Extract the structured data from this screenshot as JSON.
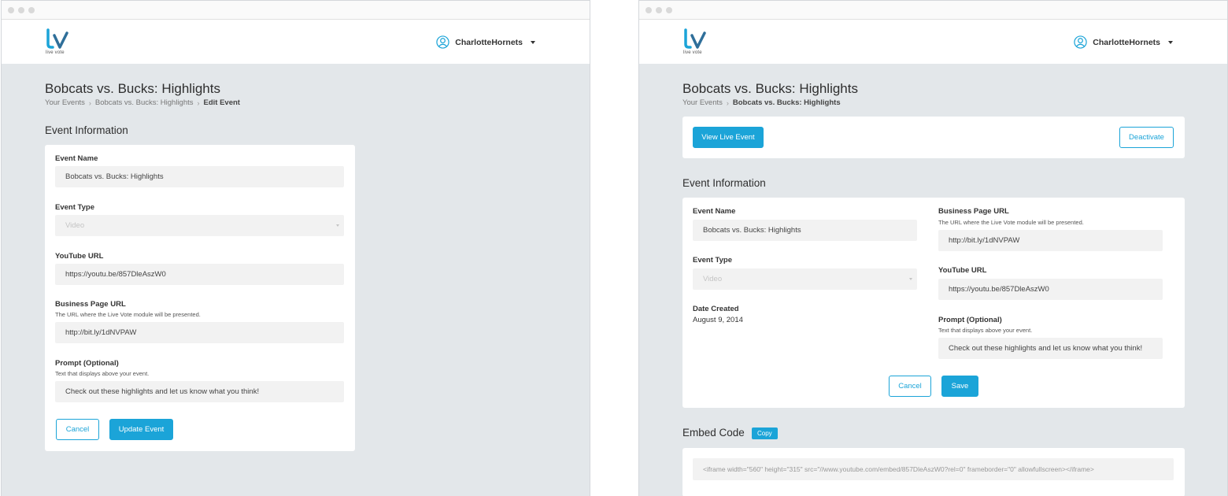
{
  "app": {
    "logo_text": "live vote",
    "user_name": "CharlotteHornets",
    "accent_color": "#1ba4d8"
  },
  "edit_screen": {
    "page_title": "Bobcats vs. Bucks: Highlights",
    "breadcrumb": [
      "Your Events",
      "Bobcats vs. Bucks: Highlights",
      "Edit Event"
    ],
    "section_title": "Event Information",
    "event_name_label": "Event Name",
    "event_name_value": "Bobcats vs. Bucks: Highlights",
    "event_type_label": "Event Type",
    "event_type_value": "Video",
    "youtube_label": "YouTube URL",
    "youtube_value": "https://youtu.be/857DleAszW0",
    "business_label": "Business Page URL",
    "business_hint": "The URL where the Live Vote module will be presented.",
    "business_value": "http://bit.ly/1dNVPAW",
    "prompt_label": "Prompt (Optional)",
    "prompt_hint": "Text that displays above your event.",
    "prompt_value": "Check out these highlights and let us know what you think!",
    "cancel_label": "Cancel",
    "update_label": "Update Event"
  },
  "detail_screen": {
    "page_title": "Bobcats vs. Bucks: Highlights",
    "breadcrumb": [
      "Your Events",
      "Bobcats vs. Bucks: Highlights"
    ],
    "view_live_label": "View Live Event",
    "deactivate_label": "Deactivate",
    "section_title": "Event Information",
    "event_name_label": "Event Name",
    "event_name_value": "Bobcats vs. Bucks: Highlights",
    "event_type_label": "Event Type",
    "event_type_value": "Video",
    "date_created_label": "Date Created",
    "date_created_value": "August 9, 2014",
    "business_label": "Business Page URL",
    "business_hint": "The URL where the Live Vote module will be presented.",
    "business_value": "http://bit.ly/1dNVPAW",
    "youtube_label": "YouTube URL",
    "youtube_value": "https://youtu.be/857DleAszW0",
    "prompt_label": "Prompt (Optional)",
    "prompt_hint": "Text that displays above your event.",
    "prompt_value": "Check out these highlights and let us know what you think!",
    "cancel_label": "Cancel",
    "save_label": "Save",
    "embed_title": "Embed Code",
    "copy_label": "Copy",
    "embed_code": "<iframe width=\"560\" height=\"315\" src=\"//www.youtube.com/embed/857DleAszW0?rel=0\" frameborder=\"0\" allowfullscreen></iframe>"
  }
}
